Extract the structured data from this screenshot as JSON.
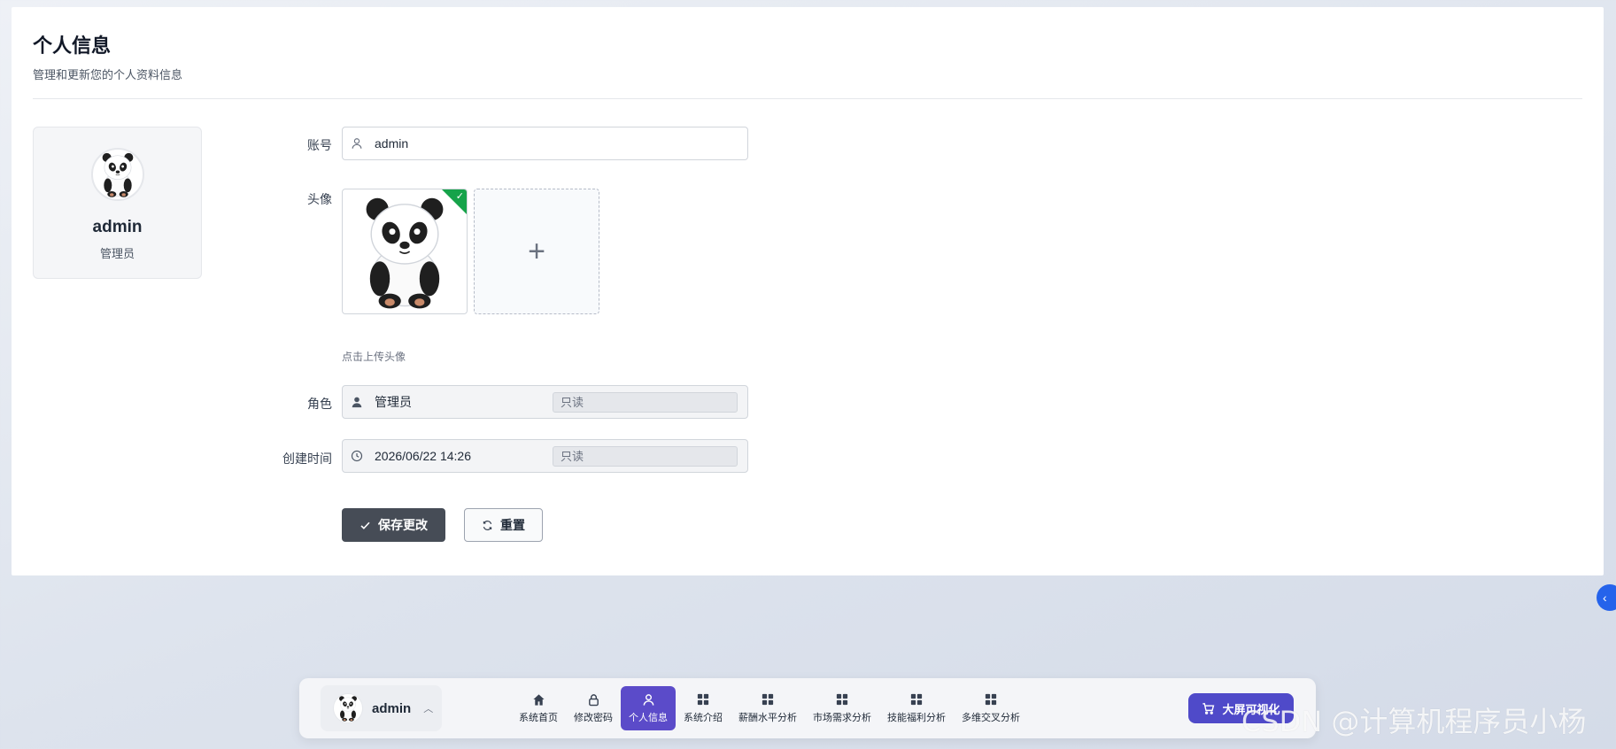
{
  "header": {
    "title": "个人信息",
    "subtitle": "管理和更新您的个人资料信息"
  },
  "profile_card": {
    "name": "admin",
    "role": "管理员"
  },
  "form": {
    "account": {
      "label": "账号",
      "value": "admin"
    },
    "avatar": {
      "label": "头像",
      "upload_hint": "点击上传头像",
      "add_symbol": "+"
    },
    "role": {
      "label": "角色",
      "value": "管理员",
      "badge": "只读"
    },
    "created": {
      "label": "创建时间",
      "value": "2026/06/22 14:26",
      "badge": "只读"
    },
    "save_label": "保存更改",
    "reset_label": "重置"
  },
  "dock": {
    "username": "admin",
    "nav": [
      {
        "label": "系统首页",
        "icon": "home-icon"
      },
      {
        "label": "修改密码",
        "icon": "lock-icon"
      },
      {
        "label": "个人信息",
        "icon": "user-icon",
        "active": true
      },
      {
        "label": "系统介绍",
        "icon": "grid-icon"
      },
      {
        "label": "薪酬水平分析",
        "icon": "grid-icon"
      },
      {
        "label": "市场需求分析",
        "icon": "grid-icon"
      },
      {
        "label": "技能福利分析",
        "icon": "grid-icon"
      },
      {
        "label": "多维交叉分析",
        "icon": "grid-icon"
      }
    ],
    "cta_label": "大屏可视化"
  },
  "watermark": "CSDN @计算机程序员小杨",
  "colors": {
    "primary_button": "#464c56",
    "active_nav": "#5b4bc9",
    "cta": "#4f4ac9",
    "success": "#16a34a"
  }
}
